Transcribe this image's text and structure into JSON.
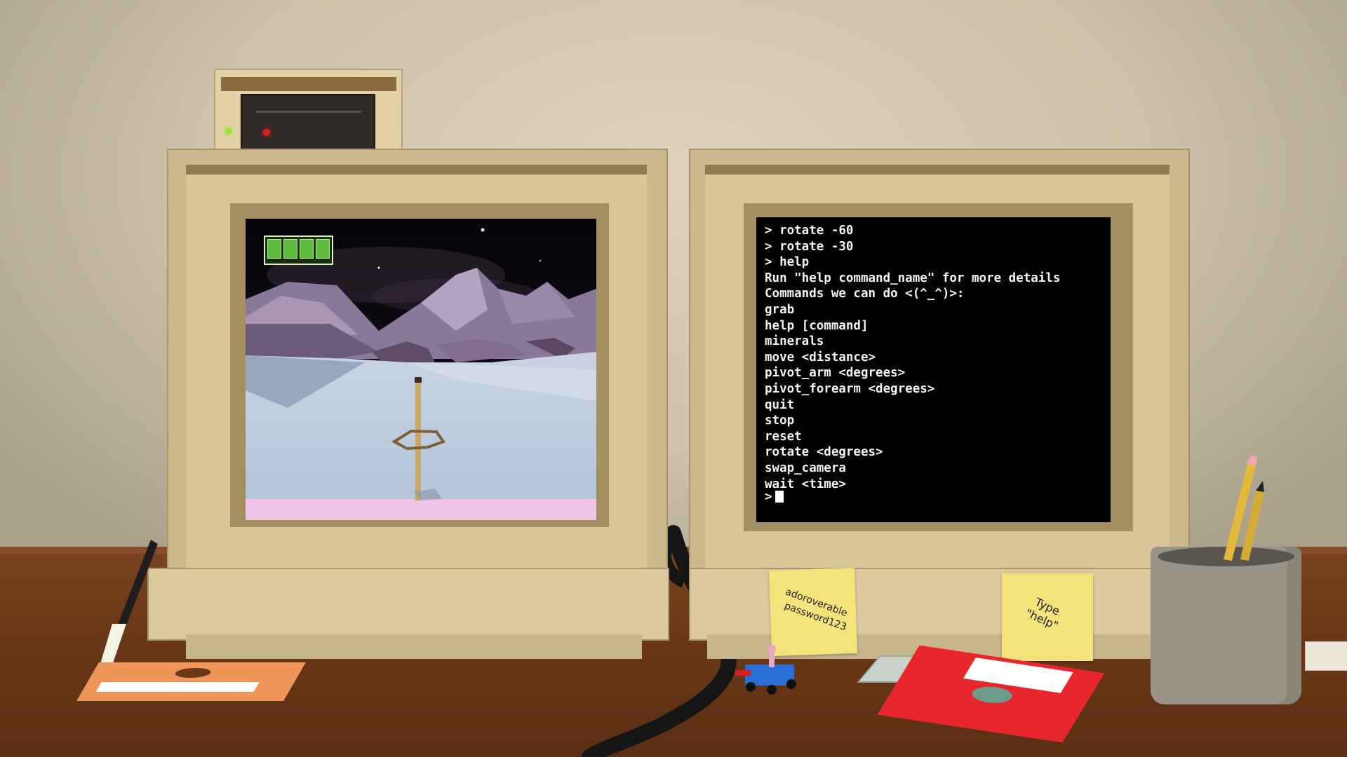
{
  "terminal": {
    "lines": [
      "> rotate -60",
      "> rotate -30",
      "> help",
      "Run \"help command_name\" for more details",
      "Commands we can do <(^_^)>:",
      "grab",
      "help [command]",
      "minerals",
      "move <distance>",
      "pivot_arm <degrees>",
      "pivot_forearm <degrees>",
      "quit",
      "stop",
      "reset",
      "rotate <degrees>",
      "swap_camera",
      "wait <time>"
    ],
    "prompt": ">"
  },
  "sticky_notes": {
    "password_line1": "adoroverable",
    "password_line2": "password123",
    "hint_line1": "Type",
    "hint_line2": "\"help\""
  },
  "rover_camera": {
    "battery_cells_total": 4,
    "battery_cells_filled": 4
  },
  "colors": {
    "terminal_text": "#f4f4f4",
    "battery_green": "#5dbb3e",
    "sticky_yellow": "#f3e37a",
    "floppy_red": "#e8262e",
    "floppy_orange": "#f0955a",
    "monitor_beige": "#cbb98e"
  }
}
